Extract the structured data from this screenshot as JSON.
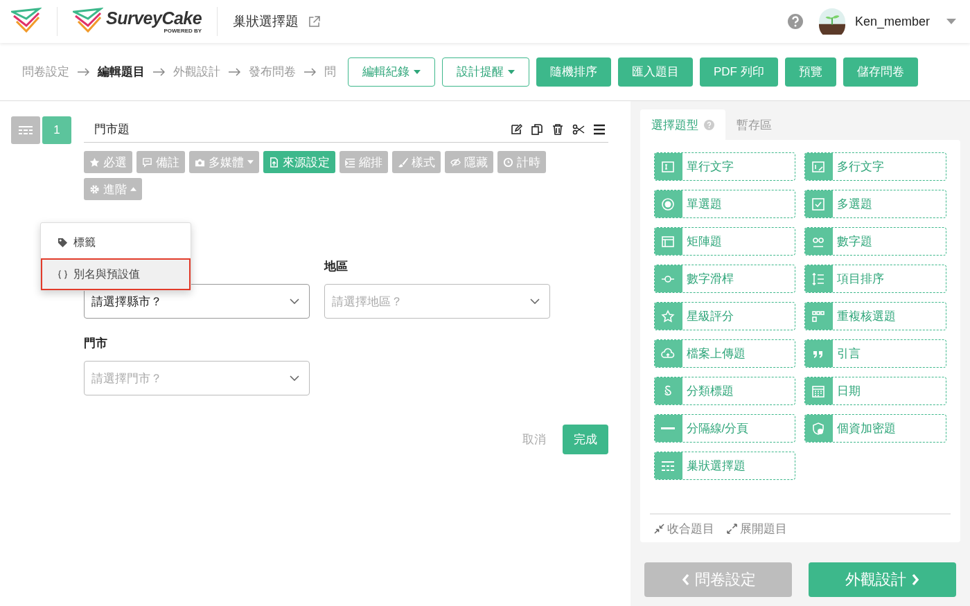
{
  "header": {
    "logo_text": "SurveyCake",
    "logo_subtext": "POWERED BY",
    "title": "巢狀選擇題",
    "username": "Ken_member"
  },
  "breadcrumb": [
    {
      "label": "問卷設定",
      "selected": false
    },
    {
      "label": "編輯題目",
      "selected": true
    },
    {
      "label": "外觀設計",
      "selected": false
    },
    {
      "label": "發布問卷",
      "selected": false
    },
    {
      "label": "問",
      "selected": false
    }
  ],
  "toolbar_buttons": [
    {
      "label": "編輯紀錄",
      "kind": "outline",
      "caret": true
    },
    {
      "label": "設計提醒",
      "kind": "outline",
      "caret": true
    },
    {
      "label": "隨機排序",
      "kind": "solid",
      "caret": false
    },
    {
      "label": "匯入題目",
      "kind": "solid",
      "caret": false
    },
    {
      "label": "PDF 列印",
      "kind": "solid",
      "caret": false
    },
    {
      "label": "預覽",
      "kind": "solid",
      "caret": false
    },
    {
      "label": "儲存問卷",
      "kind": "solid",
      "caret": false
    }
  ],
  "question": {
    "number": "1",
    "title": "門市題",
    "options": [
      {
        "label": "必選",
        "active": false,
        "caret": false
      },
      {
        "label": "備註",
        "active": false,
        "caret": false
      },
      {
        "label": "多媒體",
        "active": false,
        "caret": true
      },
      {
        "label": "來源設定",
        "active": true,
        "caret": false
      },
      {
        "label": "縮排",
        "active": false,
        "caret": false
      },
      {
        "label": "樣式",
        "active": false,
        "caret": false
      },
      {
        "label": "隱藏",
        "active": false,
        "caret": false
      },
      {
        "label": "計時",
        "active": false,
        "caret": false
      }
    ],
    "advanced": {
      "label": "進階",
      "expanded": true,
      "menu": [
        {
          "label": "標籤",
          "highlighted": false
        },
        {
          "label": "別名與預設值",
          "highlighted": true
        }
      ]
    },
    "fields": [
      {
        "value": "請選擇縣市？"
      },
      {
        "label": "地區",
        "placeholder": "請選擇地區？"
      },
      {
        "label": "門市",
        "placeholder": "請選擇門市？"
      }
    ],
    "cancel": "取消",
    "done": "完成"
  },
  "panel": {
    "tabs": [
      {
        "label": "選擇題型",
        "selected": true,
        "help": true
      },
      {
        "label": "暫存區",
        "selected": false,
        "help": false
      }
    ],
    "types": [
      "單行文字",
      "多行文字",
      "單選題",
      "多選題",
      "矩陣題",
      "數字題",
      "數字滑桿",
      "項目排序",
      "星級評分",
      "重複核選題",
      "檔案上傳題",
      "引言",
      "分類標題",
      "日期",
      "分隔線/分頁",
      "個資加密題",
      "巢狀選擇題"
    ],
    "collapse": "收合題目",
    "expand": "展開題目"
  },
  "nav": {
    "back": "問卷設定",
    "next": "外觀設計"
  }
}
